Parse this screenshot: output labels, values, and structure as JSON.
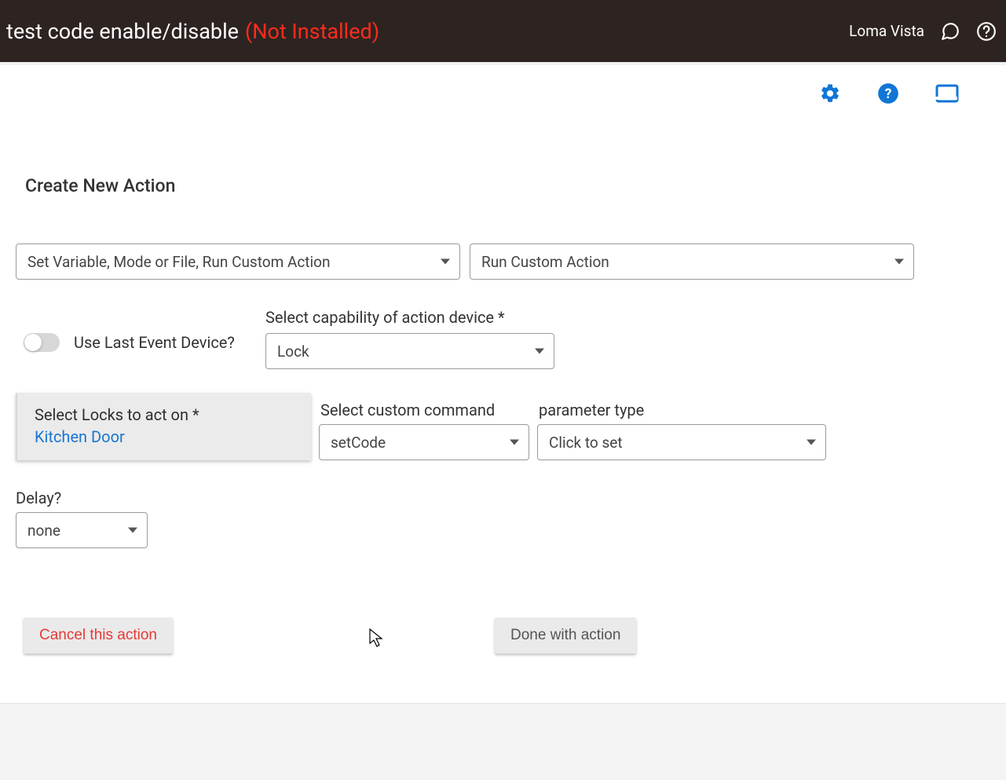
{
  "topbar": {
    "title": "test code enable/disable",
    "status": "(Not Installed)",
    "user_label": "Loma Vista"
  },
  "page": {
    "heading": "Create New Action"
  },
  "selects": {
    "action_category": "Set Variable, Mode or File, Run Custom Action",
    "action_type": "Run Custom Action",
    "capability_label": "Select capability of action device *",
    "capability_value": "Lock",
    "custom_command_label": "Select custom command",
    "custom_command_value": "setCode",
    "param_type_label": "parameter type",
    "param_type_value": "Click to set",
    "delay_label": "Delay?",
    "delay_value": "none"
  },
  "toggle": {
    "use_last_event_label": "Use Last Event Device?"
  },
  "locks_picker": {
    "label": "Select Locks to act on *",
    "value": "Kitchen Door"
  },
  "buttons": {
    "cancel": "Cancel this action",
    "done": "Done with action"
  },
  "colors": {
    "accent": "#1976d2",
    "danger": "#e53935",
    "status_red": "#ff2b1c",
    "topbar_bg": "#2d2421"
  }
}
